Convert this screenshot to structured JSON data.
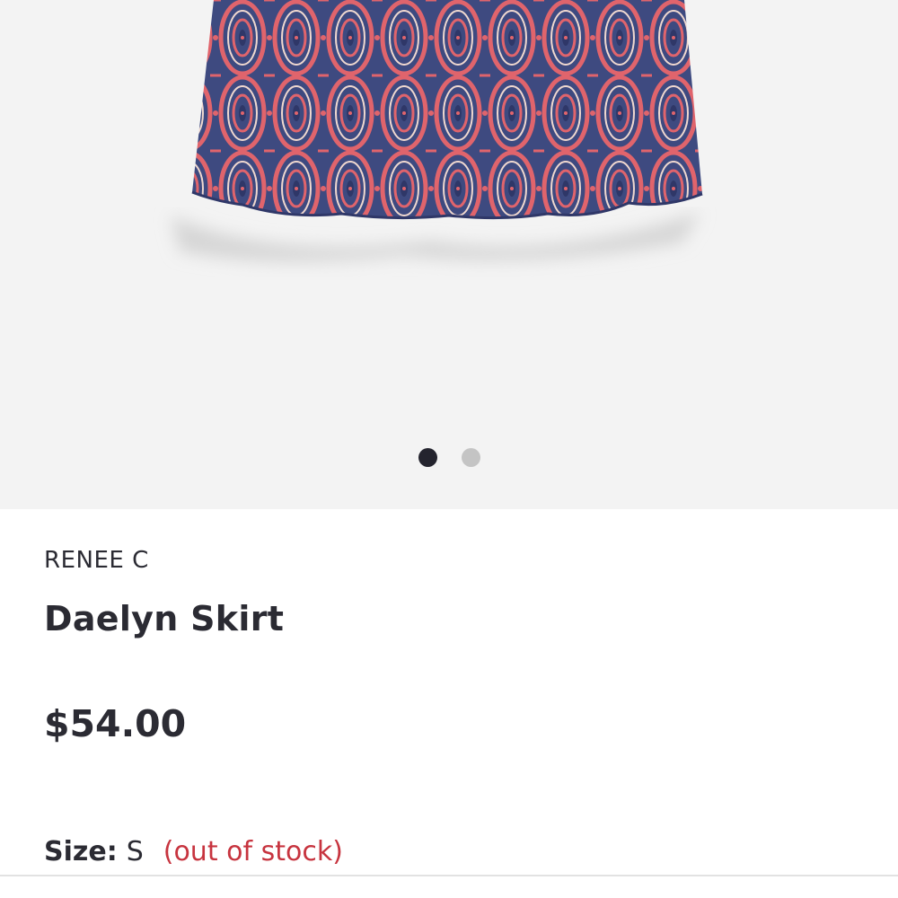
{
  "gallery": {
    "image_alt": "paisley pattern skirt",
    "pattern_colors": {
      "navy": "#3b4479",
      "coral": "#e0646c",
      "cream": "#efd9cf"
    },
    "dots": {
      "count": 2,
      "active_index": 0
    }
  },
  "product": {
    "brand": "RENEE C",
    "name": "Daelyn Skirt",
    "price": "$54.00",
    "size_label": "Size:",
    "size_value": "S",
    "stock_status": "(out of stock)"
  },
  "colors": {
    "text": "#2b2b33",
    "out_of_stock": "#c7343f",
    "background": "#f3f3f3"
  }
}
